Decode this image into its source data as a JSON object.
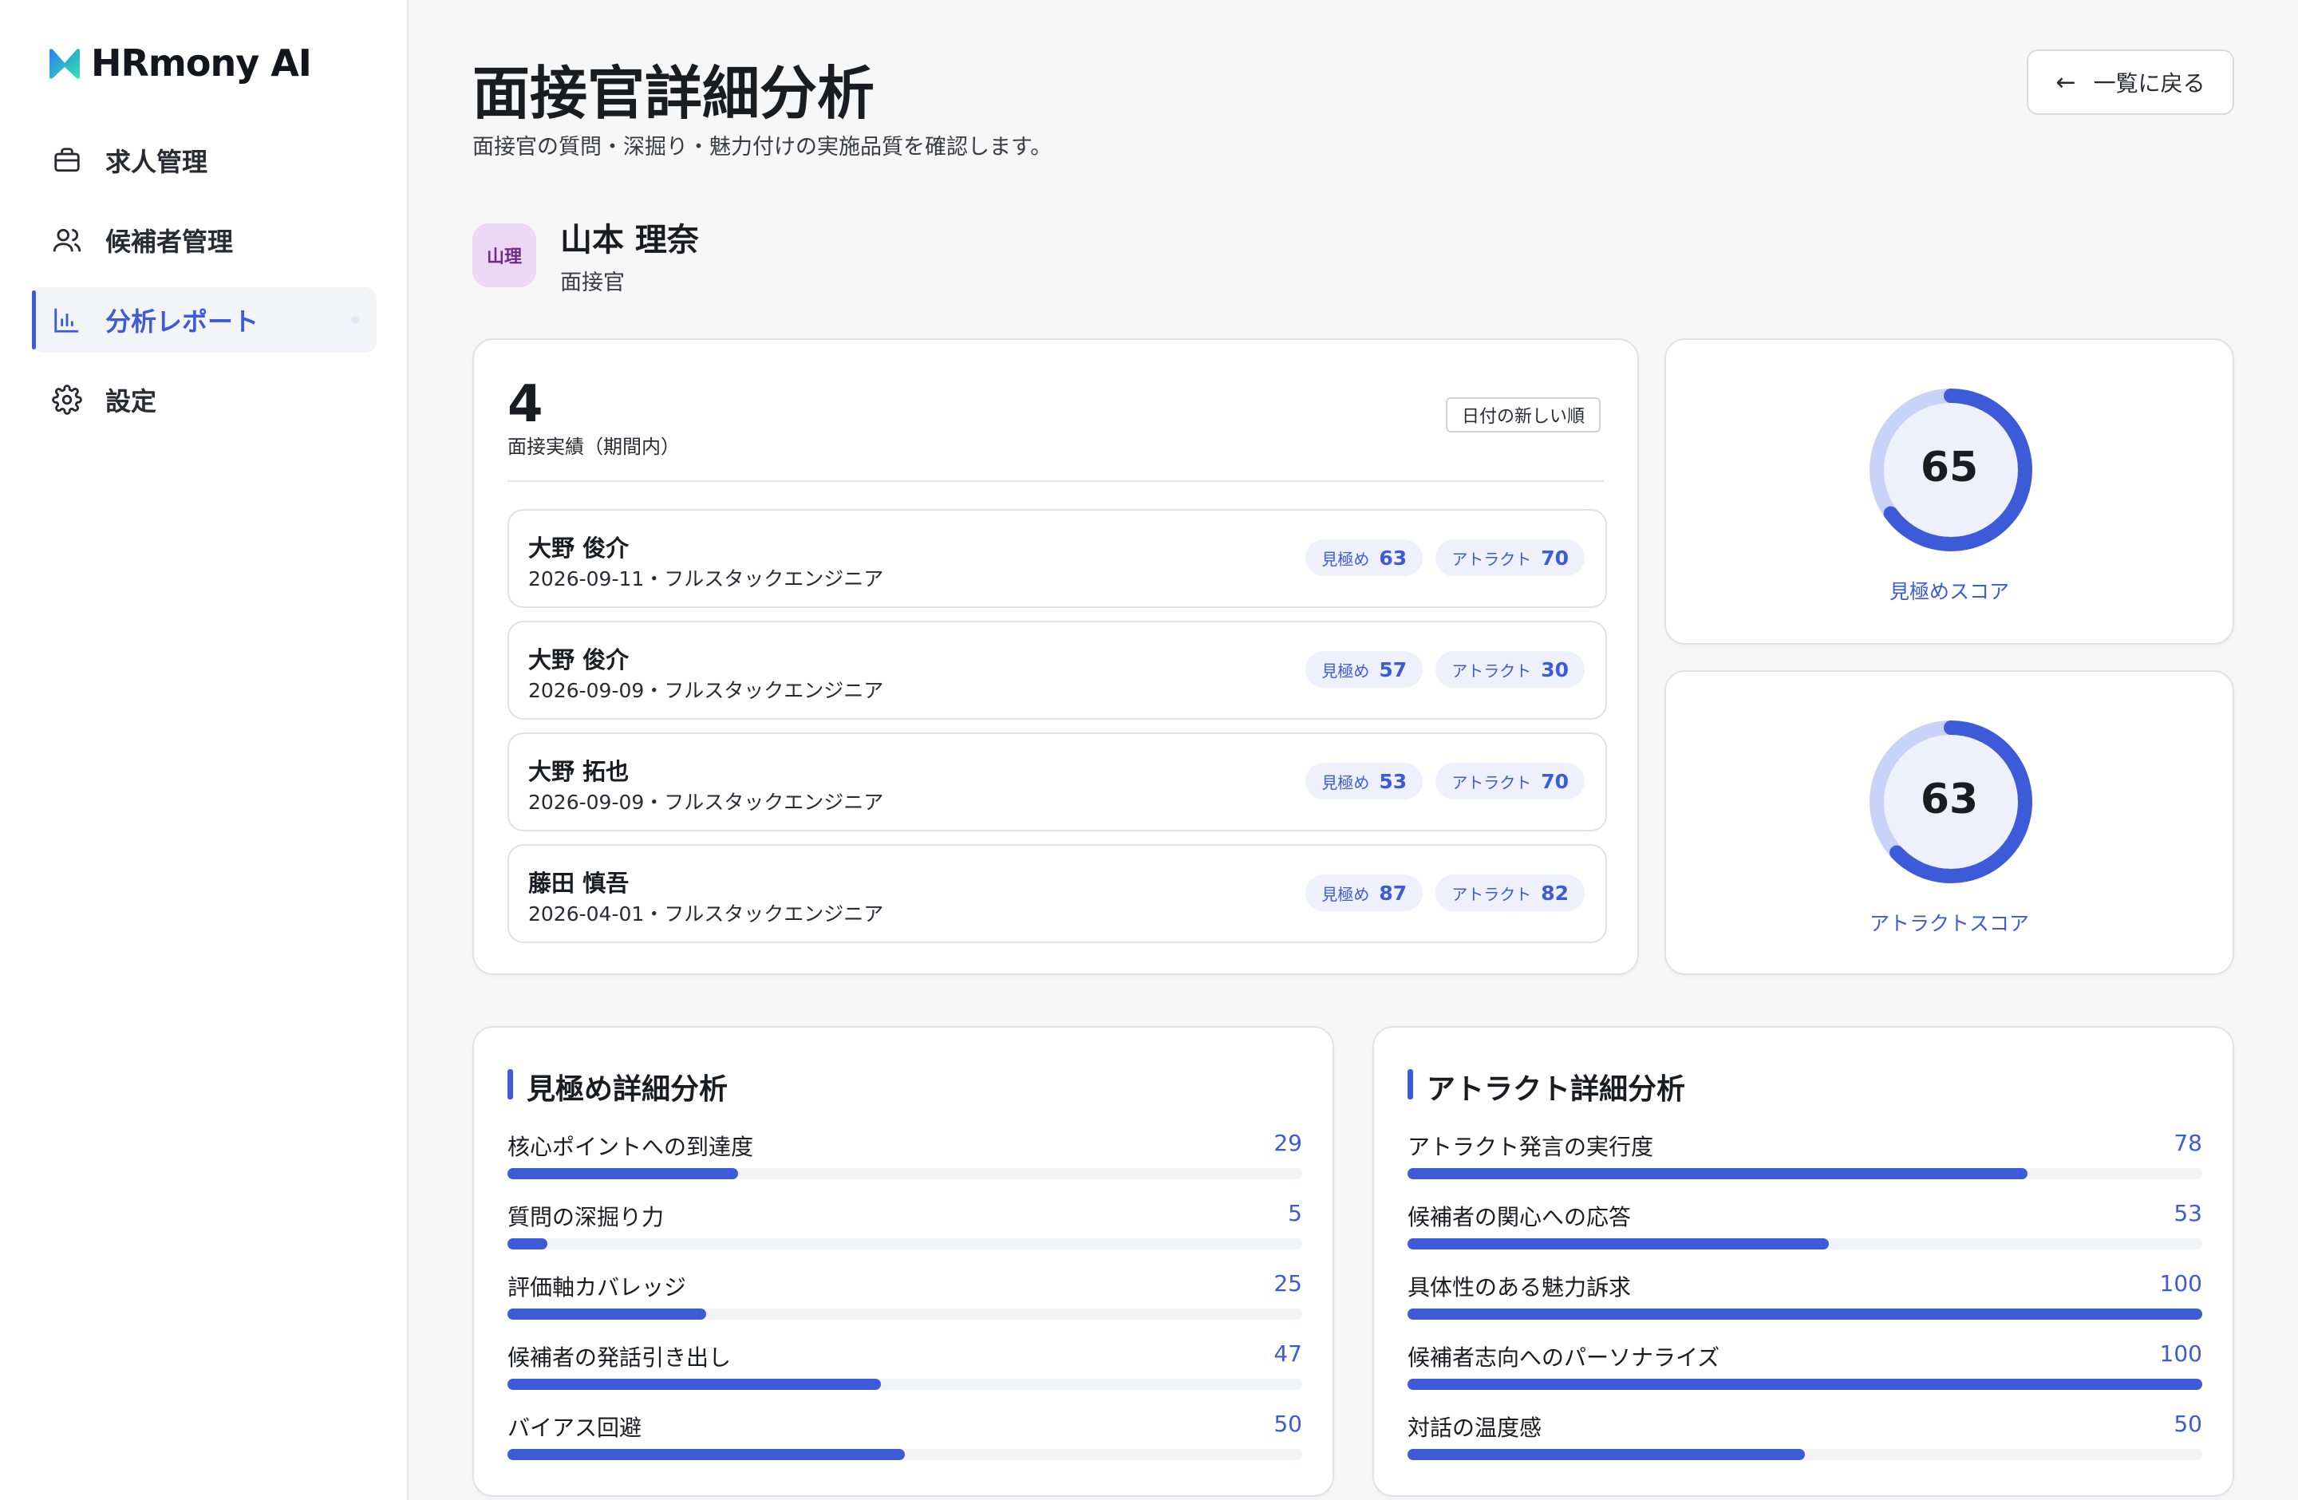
{
  "app": {
    "name": "HRmony AI"
  },
  "sidebar": {
    "items": [
      {
        "label": "求人管理",
        "icon": "briefcase-icon"
      },
      {
        "label": "候補者管理",
        "icon": "users-icon"
      },
      {
        "label": "分析レポート",
        "icon": "bar-chart-icon",
        "active": true
      },
      {
        "label": "設定",
        "icon": "gear-icon"
      }
    ]
  },
  "header": {
    "title": "面接官詳細分析",
    "subtitle": "面接官の質問・深掘り・魅力付けの実施品質を確認します。",
    "back_label": "一覧に戻る"
  },
  "interviewer": {
    "avatar_text": "山理",
    "name": "山本 理奈",
    "role": "面接官"
  },
  "interviews": {
    "count": "4",
    "count_label": "面接実績（期間内）",
    "sort_label": "日付の新しい順",
    "eval_label": "見極め",
    "attract_label": "アトラクト",
    "rows": [
      {
        "name": "大野 俊介",
        "meta": "2026-09-11・フルスタックエンジニア",
        "eval": "63",
        "attract": "70"
      },
      {
        "name": "大野 俊介",
        "meta": "2026-09-09・フルスタックエンジニア",
        "eval": "57",
        "attract": "30"
      },
      {
        "name": "大野 拓也",
        "meta": "2026-09-09・フルスタックエンジニア",
        "eval": "53",
        "attract": "70"
      },
      {
        "name": "藤田 慎吾",
        "meta": "2026-04-01・フルスタックエンジニア",
        "eval": "87",
        "attract": "82"
      }
    ]
  },
  "scores": {
    "eval": {
      "value": "65",
      "fraction": 0.65,
      "label": "見極めスコア"
    },
    "attract": {
      "value": "63",
      "fraction": 0.63,
      "label": "アトラクトスコア"
    }
  },
  "eval_detail": {
    "title": "見極め詳細分析",
    "metrics": [
      {
        "label": "核心ポイントへの到達度",
        "value": "29",
        "pct": 29
      },
      {
        "label": "質問の深掘り力",
        "value": "5",
        "pct": 5
      },
      {
        "label": "評価軸カバレッジ",
        "value": "25",
        "pct": 25
      },
      {
        "label": "候補者の発話引き出し",
        "value": "47",
        "pct": 47
      },
      {
        "label": "バイアス回避",
        "value": "50",
        "pct": 50
      }
    ]
  },
  "attract_detail": {
    "title": "アトラクト詳細分析",
    "metrics": [
      {
        "label": "アトラクト発言の実行度",
        "value": "78",
        "pct": 78
      },
      {
        "label": "候補者の関心への応答",
        "value": "53",
        "pct": 53
      },
      {
        "label": "具体性のある魅力訴求",
        "value": "100",
        "pct": 100
      },
      {
        "label": "候補者志向へのパーソナライズ",
        "value": "100",
        "pct": 100
      },
      {
        "label": "対話の温度感",
        "value": "50",
        "pct": 50
      }
    ]
  },
  "colors": {
    "accent": "#3d5bd9",
    "ring_track": "#c9d3f7",
    "ring_fill": "#3d5bd9",
    "ring_center": "#eef1fb"
  }
}
